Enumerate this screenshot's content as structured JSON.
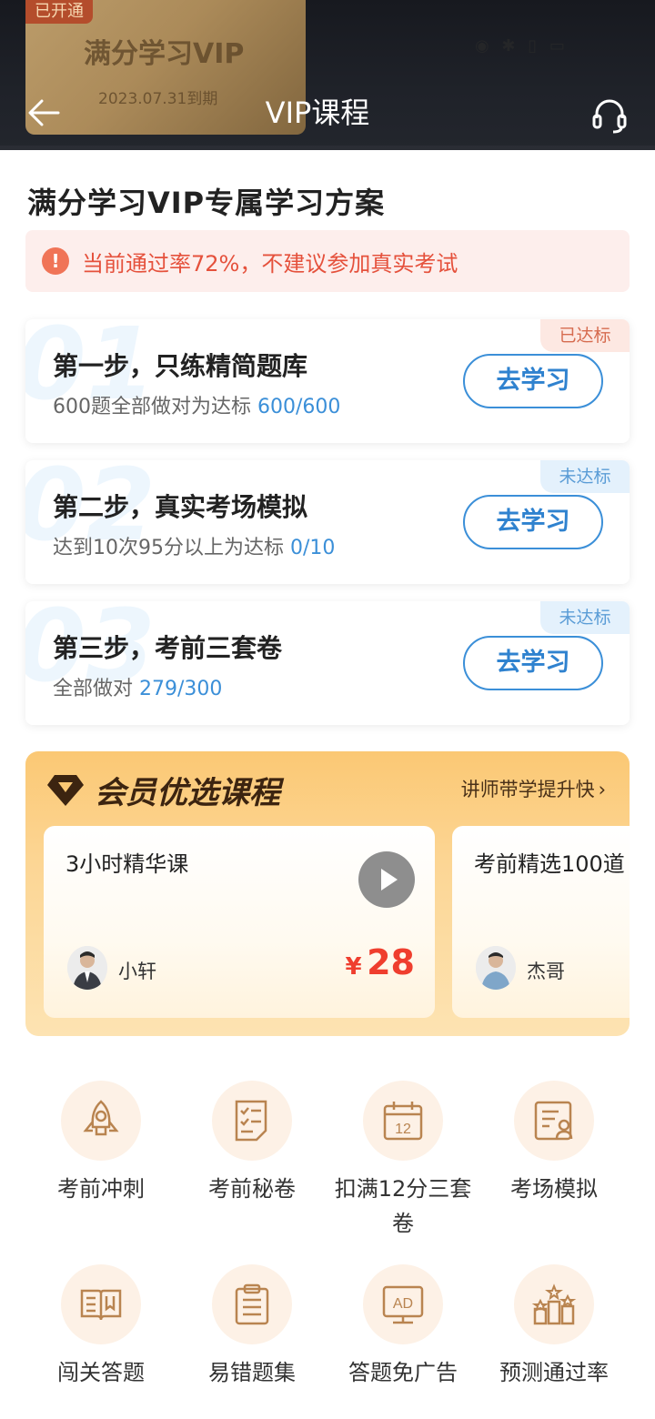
{
  "header": {
    "vip_badge": "已开通",
    "vip_name": "满分学习VIP",
    "vip_expiry": "2023.07.31到期",
    "title": "VIP课程"
  },
  "plan": {
    "title": "满分学习VIP专属学习方案",
    "warning": "当前通过率72%，不建议参加真实考试",
    "steps": [
      {
        "num": "01",
        "title": "第一步，只练精简题库",
        "desc": "600题全部做对为达标",
        "progress": "600/600",
        "status": "已达标",
        "button": "去学习"
      },
      {
        "num": "02",
        "title": "第二步，真实考场模拟",
        "desc": "达到10次95分以上为达标",
        "progress": "0/10",
        "status": "未达标",
        "button": "去学习"
      },
      {
        "num": "03",
        "title": "第三步，考前三套卷",
        "desc": "全部做对",
        "progress": "279/300",
        "status": "未达标",
        "button": "去学习"
      }
    ]
  },
  "premium": {
    "title": "会员优选课程",
    "more": "讲师带学提升快",
    "courses": [
      {
        "name": "3小时精华课",
        "teacher": "小轩",
        "price_symbol": "¥",
        "price": "28"
      },
      {
        "name": "考前精选100道",
        "teacher": "杰哥"
      }
    ]
  },
  "features": [
    {
      "label": "考前冲刺",
      "icon": "rocket-icon"
    },
    {
      "label": "考前秘卷",
      "icon": "checklist-icon"
    },
    {
      "label": "扣满12分三套卷",
      "icon": "calendar-12-icon"
    },
    {
      "label": "考场模拟",
      "icon": "exam-sim-icon"
    },
    {
      "label": "闯关答题",
      "icon": "book-icon"
    },
    {
      "label": "易错题集",
      "icon": "clipboard-icon"
    },
    {
      "label": "答题免广告",
      "icon": "ad-free-icon"
    },
    {
      "label": "预测通过率",
      "icon": "ranking-icon"
    }
  ],
  "colors": {
    "accent_blue": "#3b8fd8",
    "warning_red": "#e5513c",
    "price_red": "#ef3e2e",
    "icon_brown": "#b98450"
  }
}
